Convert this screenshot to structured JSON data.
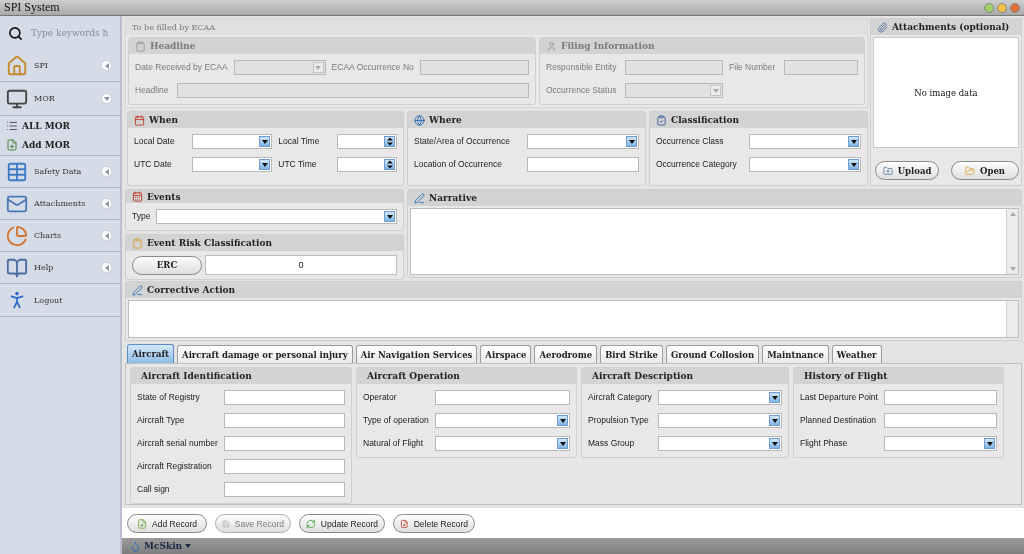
{
  "window": {
    "title": "SPI System"
  },
  "search": {
    "placeholder": "Type keywords h"
  },
  "sidebar": {
    "items": [
      {
        "label": "SPI",
        "kind": "nav",
        "expanded": false
      },
      {
        "label": "MOR",
        "kind": "nav",
        "expanded": true
      },
      {
        "label": "ALL MOR",
        "kind": "sub"
      },
      {
        "label": "Add MOR",
        "kind": "sub"
      },
      {
        "label": "Safety Data",
        "kind": "nav",
        "expanded": false
      },
      {
        "label": "Attachments",
        "kind": "nav",
        "expanded": false
      },
      {
        "label": "Charts",
        "kind": "nav",
        "expanded": false
      },
      {
        "label": "Help",
        "kind": "nav",
        "expanded": false
      },
      {
        "label": "Logout",
        "kind": "link"
      }
    ]
  },
  "ecaa": {
    "title": "To be filled by ECAA",
    "disabled": true,
    "headline": {
      "title": "Headline",
      "fields": [
        {
          "label": "Date Received by ECAA",
          "kind": "dropdown"
        },
        {
          "label": "ECAA Occurrence No",
          "kind": "text"
        },
        {
          "label": "Headline",
          "kind": "text"
        }
      ]
    },
    "filing": {
      "title": "Filing Information",
      "fields": [
        {
          "label": "Responsible Entity",
          "kind": "text"
        },
        {
          "label": "File Number",
          "kind": "text"
        },
        {
          "label": "Occurrence Status",
          "kind": "dropdown"
        }
      ]
    }
  },
  "when": {
    "title": "When",
    "fields": [
      {
        "label": "Local Date",
        "kind": "dropdown"
      },
      {
        "label": "Local Time",
        "kind": "spin"
      },
      {
        "label": "UTC Date",
        "kind": "dropdown"
      },
      {
        "label": "UTC Time",
        "kind": "spin"
      }
    ]
  },
  "where": {
    "title": "Where",
    "fields": [
      {
        "label": "State/Area of Occurrence",
        "kind": "dropdown"
      },
      {
        "label": "Location of Occurrence",
        "kind": "text"
      }
    ]
  },
  "classification": {
    "title": "Classification",
    "fields": [
      {
        "label": "Occurrence Class",
        "kind": "dropdown"
      },
      {
        "label": "Occurrence Category",
        "kind": "dropdown"
      }
    ]
  },
  "events": {
    "title": "Events",
    "fields": [
      {
        "label": "Type",
        "kind": "dropdown"
      }
    ]
  },
  "risk": {
    "title": "Event Risk Classification",
    "button": "ERC",
    "value": "0"
  },
  "narrative": {
    "title": "Narrative"
  },
  "corrective_action": {
    "title": "Corrective Action"
  },
  "attachments": {
    "title": "Attachments (optional)",
    "empty_text": "No image data",
    "buttons": [
      "Upload",
      "Open"
    ]
  },
  "tabs": [
    {
      "label": "Aircraft",
      "selected": true
    },
    {
      "label": "Aircraft damage or personal injury",
      "selected": false
    },
    {
      "label": "Air Navigation Services",
      "selected": false
    },
    {
      "label": "Airspace",
      "selected": false
    },
    {
      "label": "Aerodrome",
      "selected": false
    },
    {
      "label": "Bird Strike",
      "selected": false
    },
    {
      "label": "Ground Collosion",
      "selected": false
    },
    {
      "label": "Maintnance",
      "selected": false
    },
    {
      "label": "Weather",
      "selected": false
    }
  ],
  "sections": [
    {
      "title": "Aircraft Identification",
      "fields": [
        {
          "label": "State of Registry",
          "kind": "text"
        },
        {
          "label": "Aircraft Type",
          "kind": "text"
        },
        {
          "label": "Aircraft serial number",
          "kind": "text"
        },
        {
          "label": "Aircraft Registration",
          "kind": "text"
        },
        {
          "label": "Call sign",
          "kind": "text"
        }
      ]
    },
    {
      "title": "Aircraft Operation",
      "fields": [
        {
          "label": "Operator",
          "kind": "text"
        },
        {
          "label": "Type of operation",
          "kind": "dropdown"
        },
        {
          "label": "Natural of Flight",
          "kind": "dropdown"
        }
      ]
    },
    {
      "title": "Aircraft Description",
      "fields": [
        {
          "label": "Aircraft Category",
          "kind": "dropdown"
        },
        {
          "label": "Propulsion Type",
          "kind": "dropdown"
        },
        {
          "label": "Mass Group",
          "kind": "dropdown"
        }
      ]
    },
    {
      "title": "History of Flight",
      "fields": [
        {
          "label": "Last Departure Point",
          "kind": "text"
        },
        {
          "label": "Planned Destination",
          "kind": "text"
        },
        {
          "label": "Flight Phase",
          "kind": "dropdown"
        }
      ]
    }
  ],
  "actions": [
    {
      "label": "Add Record",
      "disabled": false
    },
    {
      "label": "Save Record",
      "disabled": true
    },
    {
      "label": "Update Record",
      "disabled": false
    },
    {
      "label": "Delete Record",
      "disabled": false
    }
  ],
  "status_bar": {
    "skin": "McSkin"
  }
}
